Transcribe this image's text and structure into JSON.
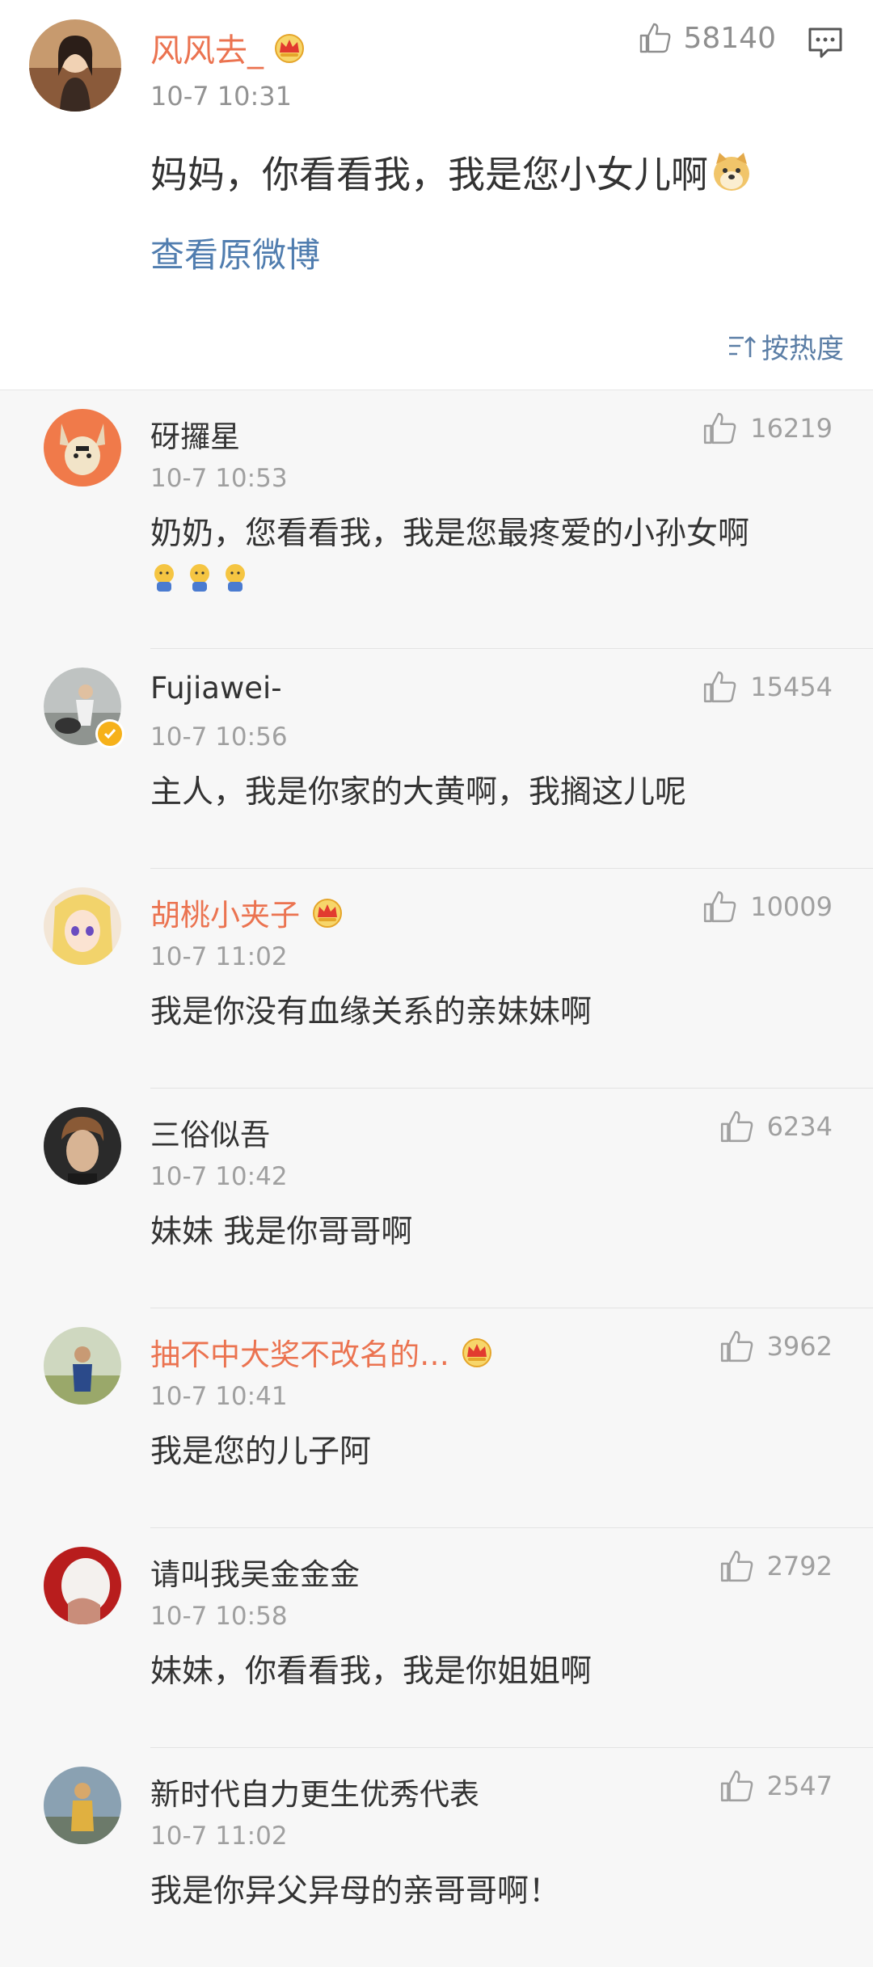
{
  "original_post": {
    "username": "风风去_",
    "time": "10-7 10:31",
    "likes": "58140",
    "text": "妈妈，你看看我，我是您小女儿啊",
    "link": "查看原微博",
    "sort_label": "按热度",
    "emoji_icon": "doge-emoji-icon"
  },
  "comments": [
    {
      "username": "砑攞星",
      "time": "10-7 10:53",
      "likes": "16219",
      "text": "奶奶，您看看我，我是您最疼爱的小孙女啊",
      "vip": false,
      "emojis": 3
    },
    {
      "username": "Fujiawei-",
      "time": "10-7 10:56",
      "likes": "15454",
      "text": "主人，我是你家的大黄啊，我搁这儿呢",
      "vip": false,
      "verified": true
    },
    {
      "username": "胡桃小夹子",
      "time": "10-7 11:02",
      "likes": "10009",
      "text": "我是你没有血缘关系的亲妹妹啊",
      "vip": true
    },
    {
      "username": "三俗似吾",
      "time": "10-7 10:42",
      "likes": "6234",
      "text": "妹妹 我是你哥哥啊",
      "vip": false
    },
    {
      "username": "抽不中大奖不改名的…",
      "time": "10-7 10:41",
      "likes": "3962",
      "text": "我是您的儿子阿",
      "vip": true
    },
    {
      "username": "请叫我吴金金金",
      "time": "10-7 10:58",
      "likes": "2792",
      "text": "妹妹，你看看我，我是你姐姐啊",
      "vip": false
    },
    {
      "username": "新时代自力更生优秀代表",
      "time": "10-7 11:02",
      "likes": "2547",
      "text": "我是你异父异母的亲哥哥啊！",
      "vip": false
    }
  ],
  "colors": {
    "vip_name": "#eb7350",
    "link": "#507daf",
    "muted": "#a0a0a0"
  }
}
